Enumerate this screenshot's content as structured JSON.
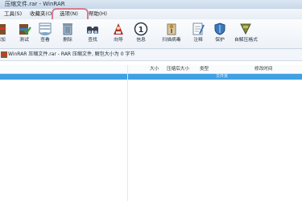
{
  "window": {
    "title": "压缩文件.rar - WinRAR"
  },
  "menu": {
    "items": [
      {
        "label": "工具(S)"
      },
      {
        "label": "收藏夹(O)"
      },
      {
        "label": "选项(N)"
      },
      {
        "label": "帮助(H)"
      }
    ]
  },
  "toolbar": {
    "items": [
      {
        "label": "添加",
        "icon": "add-icon"
      },
      {
        "label": "测试",
        "icon": "test-icon"
      },
      {
        "label": "查看",
        "icon": "view-icon"
      },
      {
        "label": "删除",
        "icon": "delete-icon"
      },
      {
        "label": "查找",
        "icon": "find-icon"
      },
      {
        "label": "向导",
        "icon": "wizard-icon"
      },
      {
        "label": "信息",
        "icon": "info-icon"
      },
      {
        "label": "扫描病毒",
        "icon": "scan-icon"
      },
      {
        "label": "注释",
        "icon": "comment-icon"
      },
      {
        "label": "保护",
        "icon": "protect-icon"
      },
      {
        "label": "自解压格式",
        "icon": "sfx-icon"
      }
    ]
  },
  "path": {
    "text": "WinRAR 压缩文件.rar - RAR 压缩文件, 解包大小为 0 字节"
  },
  "columns": {
    "size": "大小",
    "packed": "压缩后大小",
    "type": "类型",
    "modified": "修改时间"
  },
  "rows": [
    {
      "name": "..",
      "type": "文件夹"
    }
  ],
  "colors": {
    "selection": "#3fa0e4",
    "highlight_box": "#d77c8f"
  }
}
